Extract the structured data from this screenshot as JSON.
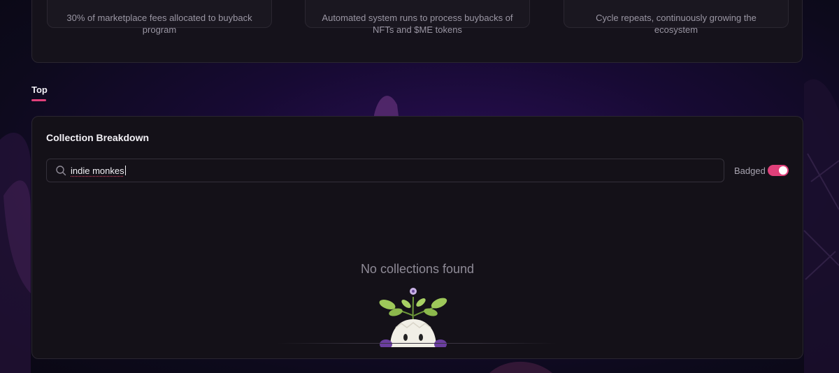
{
  "info_cards": [
    {
      "description": "30% of marketplace fees allocated to buyback program"
    },
    {
      "description": "Automated system runs to process buybacks of NFTs and $ME tokens"
    },
    {
      "description": "Cycle repeats, continuously growing the ecosystem"
    }
  ],
  "tabs": [
    {
      "label": "Top",
      "active": true
    }
  ],
  "collection_breakdown": {
    "title": "Collection Breakdown",
    "search": {
      "value": "indie monkes",
      "icon": "search-icon"
    },
    "badged_toggle": {
      "label": "Badged",
      "on": true
    },
    "empty_state": {
      "message": "No collections found",
      "illustration": "sprout-egg-mascot-icon"
    }
  },
  "colors": {
    "accent": "#e0407a",
    "panel_bg": "#141118",
    "page_bg": "#170a33"
  }
}
